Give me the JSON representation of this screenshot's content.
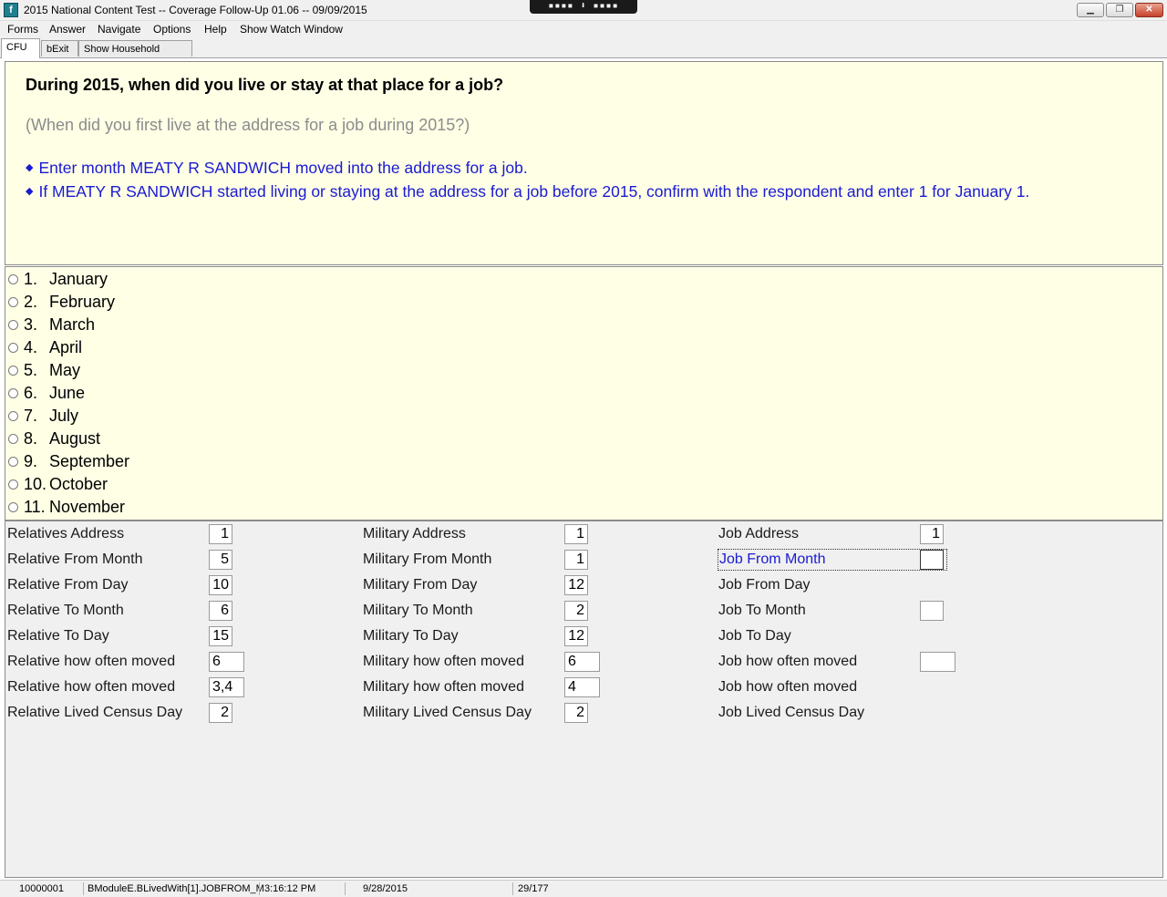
{
  "window": {
    "title": "2015 National Content Test -- Coverage Follow-Up 01.06 -- 09/09/2015",
    "remote_toolbar": "▪▪▪▪ ⬇ ▪▪▪▪"
  },
  "menu": [
    "Forms",
    "Answer",
    "Navigate",
    "Options",
    "Help",
    "Show Watch Window"
  ],
  "tabs": [
    "CFU",
    "bExit",
    "Show Household Roster"
  ],
  "question": {
    "main": "During 2015, when did you live or stay at that place for a job?",
    "sub": "(When did you first live at the address for a job during 2015?)",
    "instructions": [
      "Enter month MEATY R SANDWICH moved into the address for a job.",
      "If MEATY R SANDWICH started living or staying at the address for a job before 2015, confirm with the respondent and enter 1 for January 1."
    ]
  },
  "options": [
    {
      "num": "1.",
      "label": "January"
    },
    {
      "num": "2.",
      "label": "February"
    },
    {
      "num": "3.",
      "label": "March"
    },
    {
      "num": "4.",
      "label": "April"
    },
    {
      "num": "5.",
      "label": "May"
    },
    {
      "num": "6.",
      "label": "June"
    },
    {
      "num": "7.",
      "label": "July"
    },
    {
      "num": "8.",
      "label": "August"
    },
    {
      "num": "9.",
      "label": "September"
    },
    {
      "num": "10.",
      "label": "October"
    },
    {
      "num": "11.",
      "label": "November"
    }
  ],
  "fields": {
    "relative": [
      {
        "label": "Relatives Address",
        "value": "1"
      },
      {
        "label": "Relative From Month",
        "value": "5"
      },
      {
        "label": "Relative From Day",
        "value": "10"
      },
      {
        "label": "Relative To Month",
        "value": "6"
      },
      {
        "label": "Relative To Day",
        "value": "15"
      },
      {
        "label": "Relative how often moved",
        "value": "6"
      },
      {
        "label": "Relative how often moved",
        "value": "3,4"
      },
      {
        "label": "Relative Lived Census Day",
        "value": "2"
      }
    ],
    "military": [
      {
        "label": "Military Address",
        "value": "1"
      },
      {
        "label": "Military From Month",
        "value": "1"
      },
      {
        "label": "Military From Day",
        "value": "12"
      },
      {
        "label": "Military To Month",
        "value": "2"
      },
      {
        "label": "Military To Day",
        "value": "12"
      },
      {
        "label": "Military how often moved",
        "value": "6"
      },
      {
        "label": "Military how often moved",
        "value": "4"
      },
      {
        "label": "Military Lived Census Day",
        "value": "2"
      }
    ],
    "job": [
      {
        "label": "Job Address",
        "value": "1"
      },
      {
        "label": "Job From Month",
        "value": ""
      },
      {
        "label": "Job From Day",
        "value": ""
      },
      {
        "label": "Job To Month",
        "value": ""
      },
      {
        "label": "Job To Day",
        "value": ""
      },
      {
        "label": "Job how often moved",
        "value": ""
      },
      {
        "label": "Job how often moved",
        "value": ""
      },
      {
        "label": "Job Lived Census Day",
        "value": ""
      }
    ]
  },
  "status": {
    "case_id": "10000001",
    "field_path": "BModuleE.BLivedWith[1].JOBFROM_M",
    "time": "3:16:12 PM",
    "date": "9/28/2015",
    "page": "29/177"
  }
}
